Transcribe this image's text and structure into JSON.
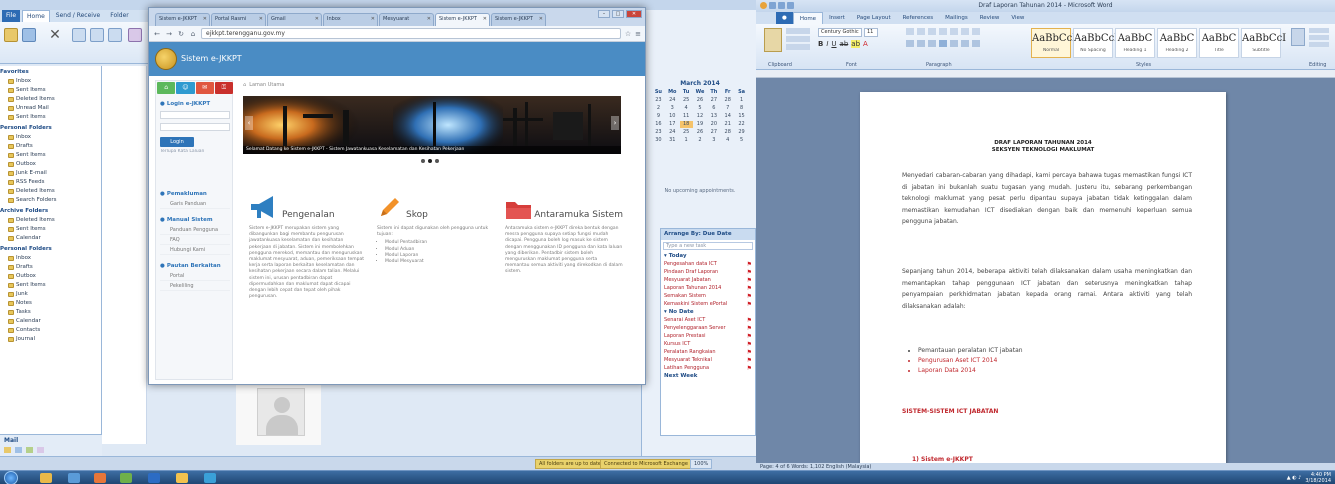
{
  "outlook": {
    "tabs": [
      "Home",
      "Send / Receive",
      "Folder"
    ],
    "nav_sections": [
      {
        "title": "Favorites",
        "items": [
          "Inbox",
          "Sent Items",
          "Deleted Items",
          "Unread Mail",
          "Sent Items"
        ]
      },
      {
        "title": "Personal Folders",
        "items": [
          "Inbox",
          "Drafts",
          "Sent Items",
          "Outbox",
          "Junk E-mail",
          "RSS Feeds",
          "Deleted Items",
          "Search Folders"
        ]
      },
      {
        "title": "Archive Folders",
        "items": [
          "Deleted Items",
          "Sent Items",
          "Calendar"
        ]
      },
      {
        "title": "Personal Folders",
        "items": [
          "Inbox",
          "Drafts",
          "Outbox",
          "Sent Items",
          "Junk",
          "Notes",
          "Tasks",
          "Calendar",
          "Contacts",
          "Journal"
        ]
      }
    ],
    "bottom_label": "Mail",
    "status_items": [
      "All folders are up to date.",
      "Connected to Microsoft Exchange",
      "100%"
    ],
    "calendar": {
      "month": "March 2014",
      "days": [
        "Su",
        "Mo",
        "Tu",
        "We",
        "Th",
        "Fr",
        "Sa"
      ],
      "dates": [
        "23",
        "24",
        "25",
        "26",
        "27",
        "28",
        "1",
        "2",
        "3",
        "4",
        "5",
        "6",
        "7",
        "8",
        "9",
        "10",
        "11",
        "12",
        "13",
        "14",
        "15",
        "16",
        "17",
        "18",
        "19",
        "20",
        "21",
        "22",
        "23",
        "24",
        "25",
        "26",
        "27",
        "28",
        "29",
        "30",
        "31",
        "1",
        "2",
        "3",
        "4",
        "5"
      ],
      "today": "18"
    },
    "appointments_empty": "No upcoming appointments.",
    "todo": {
      "header": "Arrange By: Due Date",
      "search_placeholder": "Type a new task",
      "groups": [
        {
          "name": "Today",
          "items": [
            "Pengesahan data ICT",
            "Pindaan Draf Laporan",
            "Mesyuarat Jabatan",
            "Laporan Tahunan 2014",
            "Semakan Sistem",
            "Kemaskini Sistem ePortal"
          ]
        },
        {
          "name": "No Date",
          "items": [
            "Senarai Aset ICT",
            "Penyelenggaraan Server",
            "Laporan Prestasi",
            "Kursus ICT",
            "Peralatan Rangkaian",
            "Mesyuarat Teknikal",
            "Latihan Pengguna"
          ]
        }
      ],
      "footer": "Next Week"
    }
  },
  "chrome": {
    "tabs": [
      "Sistem e-JKKPT",
      "Portal Rasmi",
      "Gmail",
      "Inbox",
      "Mesyuarat",
      "Sistem e-JKKPT",
      "Sistem e-JKKPT"
    ],
    "url": "ejkkpt.terengganu.gov.my",
    "site_title": "Sistem e-JKKPT",
    "sidebar": {
      "login_head": "Login e-JKKPT",
      "login_button": "Login",
      "forgot": "Terlupa Kata Laluan",
      "menu": [
        {
          "head": "Pemakluman",
          "links": [
            "Garis Panduan"
          ]
        },
        {
          "head": "Manual Sistem",
          "links": [
            "Panduan Pengguna",
            "FAQ",
            "Hubungi Kami"
          ]
        },
        {
          "head": "Pautan Berkaitan",
          "links": [
            "Portal",
            "Pekeliling"
          ]
        }
      ]
    },
    "breadcrumb": "Laman Utama",
    "banner_caption": "Selamat Datang ke Sistem e-JKKPT - Sistem Jawatankuasa Keselamatan dan Kesihatan Pekerjaan",
    "features": [
      {
        "title": "Pengenalan",
        "color": "#2e7fc1",
        "text": "Sistem e-JKKPT merupakan sistem yang dibangunkan bagi membantu pengurusan jawatankuasa keselamatan dan kesihatan pekerjaan di jabatan. Sistem ini membolehkan pengguna merekod, memantau dan menguruskan maklumat mesyuarat, aduan, pemeriksaan tempat kerja serta laporan berkaitan keselamatan dan kesihatan pekerjaan secara dalam talian. Melalui sistem ini, urusan pentadbiran dapat dipermudahkan dan maklumat dapat dicapai dengan lebih cepat dan tepat oleh pihak pengurusan.",
        "list": []
      },
      {
        "title": "Skop",
        "color": "#f2922a",
        "text": "Sistem ini dapat digunakan oleh pengguna untuk tujuan:",
        "list": [
          "Modul Pentadbiran",
          "Modul Aduan",
          "Modul Laporan",
          "Modul Mesyuarat"
        ]
      },
      {
        "title": "Antaramuka Sistem",
        "color": "#d63e3b",
        "text": "Antaramuka sistem e-JKKPT direka bentuk dengan mesra pengguna supaya setiap fungsi mudah dicapai. Pengguna boleh log masuk ke sistem dengan menggunakan ID pengguna dan kata laluan yang diberikan. Pentadbir sistem boleh menguruskan maklumat pengguna serta memantau semua aktiviti yang direkodkan di dalam sistem.",
        "list": []
      }
    ]
  },
  "word": {
    "title": "Draf Laporan Tahunan 2014 - Microsoft Word",
    "tabs": [
      "Home",
      "Insert",
      "Page Layout",
      "References",
      "Mailings",
      "Review",
      "View"
    ],
    "font_name": "Century Gothic",
    "font_size": "11",
    "styles": [
      {
        "sample": "AaBbCcDd",
        "name": "Normal"
      },
      {
        "sample": "AaBbCcDd",
        "name": "No Spacing"
      },
      {
        "sample": "AaBbC",
        "name": "Heading 1"
      },
      {
        "sample": "AaBbC",
        "name": "Heading 2"
      },
      {
        "sample": "AaBbC",
        "name": "Title"
      },
      {
        "sample": "AaBbCcI",
        "name": "Subtitle"
      }
    ],
    "groups": [
      "Clipboard",
      "Font",
      "Paragraph",
      "Styles",
      "Editing"
    ],
    "doc": {
      "heading1": "DRAF LAPORAN TAHUNAN 2014",
      "heading2": "SEKSYEN TEKNOLOGI MAKLUMAT",
      "para1": "Menyedari cabaran-cabaran yang dihadapi, kami percaya bahawa tugas memastikan fungsi ICT di jabatan ini bukanlah suatu tugasan yang mudah. Justeru itu, sebarang perkembangan teknologi maklumat yang pesat perlu dipantau supaya jabatan tidak ketinggalan dalam memastikan kemudahan ICT disediakan dengan baik dan memenuhi keperluan semua pengguna jabatan.",
      "para2": "Sepanjang tahun 2014, beberapa aktiviti telah dilaksanakan dalam usaha meningkatkan dan memantapkan tahap penggunaan ICT jabatan dan seterusnya meningkatkan tahap penyampaian perkhidmatan jabatan kepada orang ramai. Antara aktiviti yang telah dilaksanakan adalah:",
      "bullets": [
        "Pemantauan peralatan ICT jabatan",
        "Pengurusan Aset ICT 2014",
        "Laporan Data 2014"
      ],
      "section": "SISTEM-SISTEM ICT JABATAN",
      "subsection": "1) Sistem e-JKKPT"
    },
    "status": "Page: 4 of 6   Words: 1,102   English (Malaysia)"
  },
  "taskbar": {
    "time": "4:40 PM",
    "date": "3/18/2014"
  }
}
